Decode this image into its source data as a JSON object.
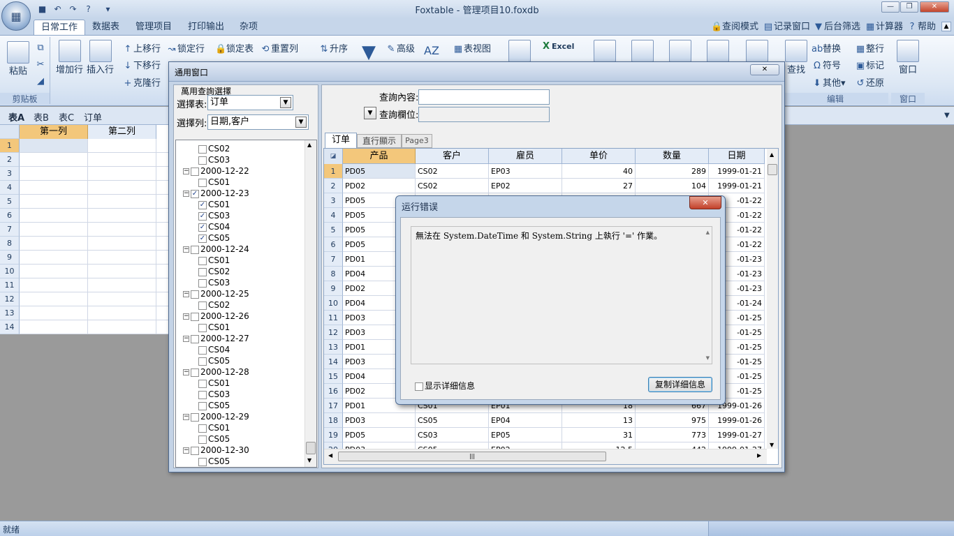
{
  "app": {
    "title": "Foxtable - 管理项目10.foxdb",
    "status": "就绪"
  },
  "ribbon_tabs": [
    "日常工作",
    "数据表",
    "管理项目",
    "打印输出",
    "杂项"
  ],
  "ribbon_right": [
    "查阅模式",
    "记录窗口",
    "后台筛选",
    "计算器",
    "帮助"
  ],
  "ribbon": {
    "paste": "粘贴",
    "add_row": "增加行",
    "insert_row": "插入行",
    "clipboard_label": "剪贴板",
    "move_up": "上移行",
    "move_down": "下移行",
    "clone_row": "克隆行",
    "lock_row": "锁定行",
    "lock_table": "锁定表",
    "reset_cols": "重置列",
    "sort_asc": "升序",
    "advanced": "高级",
    "table_view": "表视图",
    "excel": "Excel",
    "find": "查找",
    "replace": "替换",
    "symbol": "符号",
    "other": "其他",
    "tidy_row": "整行",
    "mark": "标记",
    "restore": "还原",
    "edit_label": "编辑",
    "window": "窗口",
    "window_label": "窗口"
  },
  "sheet_tabs": [
    "表A",
    "表B",
    "表C",
    "订单"
  ],
  "bg_grid": {
    "cols": [
      "第一列",
      "第二列"
    ],
    "rows": [
      "1",
      "2",
      "3",
      "4",
      "5",
      "6",
      "7",
      "8",
      "9",
      "10",
      "11",
      "12",
      "13",
      "14"
    ]
  },
  "query_window": {
    "title": "通用窗口",
    "group_title": "萬用查詢選擇",
    "table_label": "選擇表:",
    "table_value": "订单",
    "col_label": "選擇列:",
    "col_value": "日期,客户",
    "content_label": "查詢內容:",
    "field_label": "查詢欄位:",
    "tabs": [
      "订单",
      "直行顯示",
      "Page3"
    ],
    "tree": [
      {
        "t": "CS02",
        "lvl": 1,
        "c": false
      },
      {
        "t": "CS03",
        "lvl": 1,
        "c": false
      },
      {
        "t": "2000-12-22",
        "lvl": 0,
        "c": false
      },
      {
        "t": "CS01",
        "lvl": 1,
        "c": false
      },
      {
        "t": "2000-12-23",
        "lvl": 0,
        "c": true
      },
      {
        "t": "CS01",
        "lvl": 1,
        "c": true
      },
      {
        "t": "CS03",
        "lvl": 1,
        "c": true
      },
      {
        "t": "CS04",
        "lvl": 1,
        "c": true
      },
      {
        "t": "CS05",
        "lvl": 1,
        "c": true
      },
      {
        "t": "2000-12-24",
        "lvl": 0,
        "c": false
      },
      {
        "t": "CS01",
        "lvl": 1,
        "c": false
      },
      {
        "t": "CS02",
        "lvl": 1,
        "c": false
      },
      {
        "t": "CS03",
        "lvl": 1,
        "c": false
      },
      {
        "t": "2000-12-25",
        "lvl": 0,
        "c": false
      },
      {
        "t": "CS02",
        "lvl": 1,
        "c": false
      },
      {
        "t": "2000-12-26",
        "lvl": 0,
        "c": false
      },
      {
        "t": "CS01",
        "lvl": 1,
        "c": false
      },
      {
        "t": "2000-12-27",
        "lvl": 0,
        "c": false
      },
      {
        "t": "CS04",
        "lvl": 1,
        "c": false
      },
      {
        "t": "CS05",
        "lvl": 1,
        "c": false
      },
      {
        "t": "2000-12-28",
        "lvl": 0,
        "c": false
      },
      {
        "t": "CS01",
        "lvl": 1,
        "c": false
      },
      {
        "t": "CS03",
        "lvl": 1,
        "c": false
      },
      {
        "t": "CS05",
        "lvl": 1,
        "c": false
      },
      {
        "t": "2000-12-29",
        "lvl": 0,
        "c": false
      },
      {
        "t": "CS01",
        "lvl": 1,
        "c": false
      },
      {
        "t": "CS05",
        "lvl": 1,
        "c": false
      },
      {
        "t": "2000-12-30",
        "lvl": 0,
        "c": false
      },
      {
        "t": "CS05",
        "lvl": 1,
        "c": false
      }
    ],
    "grid_cols": [
      "产品",
      "客户",
      "雇员",
      "单价",
      "数量",
      "日期"
    ],
    "grid_rows": [
      [
        "1",
        "PD05",
        "CS02",
        "EP03",
        "40",
        "289",
        "1999-01-21"
      ],
      [
        "2",
        "PD02",
        "CS02",
        "EP02",
        "27",
        "104",
        "1999-01-21"
      ],
      [
        "3",
        "PD05",
        "",
        "",
        "",
        "",
        "-01-22"
      ],
      [
        "4",
        "PD05",
        "",
        "",
        "",
        "",
        "-01-22"
      ],
      [
        "5",
        "PD05",
        "",
        "",
        "",
        "",
        "-01-22"
      ],
      [
        "6",
        "PD05",
        "",
        "",
        "",
        "",
        "-01-22"
      ],
      [
        "7",
        "PD01",
        "",
        "",
        "",
        "",
        "-01-23"
      ],
      [
        "8",
        "PD04",
        "",
        "",
        "",
        "",
        "-01-23"
      ],
      [
        "9",
        "PD02",
        "",
        "",
        "",
        "",
        "-01-23"
      ],
      [
        "10",
        "PD04",
        "",
        "",
        "",
        "",
        "-01-24"
      ],
      [
        "11",
        "PD03",
        "",
        "",
        "",
        "",
        "-01-25"
      ],
      [
        "12",
        "PD03",
        "",
        "",
        "",
        "",
        "-01-25"
      ],
      [
        "13",
        "PD01",
        "",
        "",
        "",
        "",
        "-01-25"
      ],
      [
        "14",
        "PD03",
        "",
        "",
        "",
        "",
        "-01-25"
      ],
      [
        "15",
        "PD04",
        "",
        "",
        "",
        "",
        "-01-25"
      ],
      [
        "16",
        "PD02",
        "",
        "",
        "",
        "",
        "-01-25"
      ],
      [
        "17",
        "PD01",
        "CS01",
        "EP01",
        "18",
        "667",
        "1999-01-26"
      ],
      [
        "18",
        "PD03",
        "CS05",
        "EP04",
        "13",
        "975",
        "1999-01-26"
      ],
      [
        "19",
        "PD05",
        "CS03",
        "EP05",
        "31",
        "773",
        "1999-01-27"
      ],
      [
        "20",
        "PD03",
        "CS05",
        "EP02",
        "12.5",
        "442",
        "1999-01-27"
      ]
    ]
  },
  "error_dialog": {
    "title": "运行错误",
    "message": "無法在 System.DateTime 和 System.String 上執行 '=' 作業。",
    "show_details": "显示详细信息",
    "copy_details": "复制详细信息"
  }
}
